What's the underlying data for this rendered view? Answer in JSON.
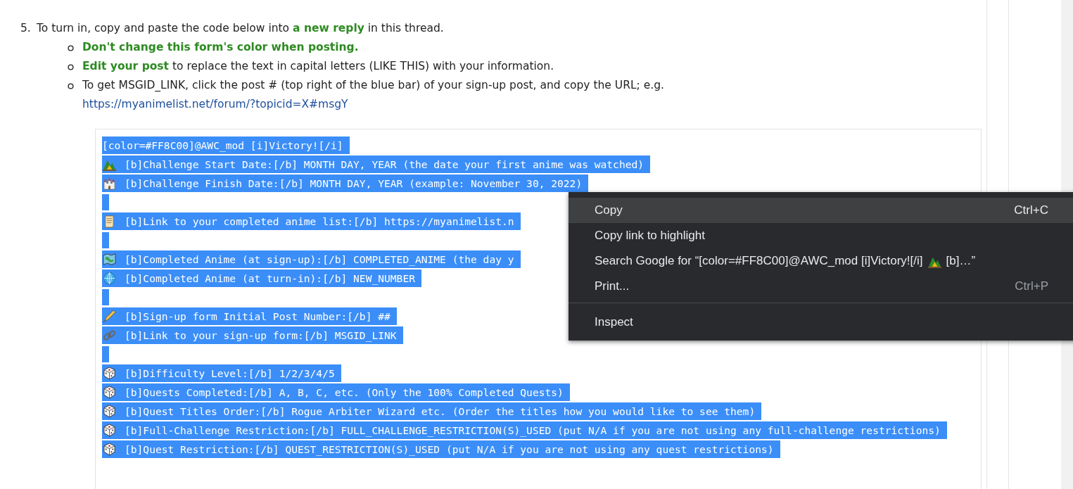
{
  "instructions": {
    "number": "5.",
    "text": "To turn in, copy and paste the code below into **a new reply** in this thread.",
    "bullets": [
      {
        "text": "**Don't change this form's color when posting.**"
      },
      {
        "text": "**Edit your post** to replace the text in capital letters (LIKE THIS) with your information."
      },
      {
        "text": "To get MSGID_LINK, click the post # (top right of the blue bar) of your sign-up post, and copy the URL; e.g.",
        "link": "https://myanimelist.net/forum/?topicid=X#msgY"
      }
    ]
  },
  "code_lines": [
    {
      "kind": "plain",
      "text": "[color=#FF8C00]@AWC_mod [i]Victory![/i]"
    },
    {
      "kind": "camp",
      "text": "[b]Challenge Start Date:[/b] MONTH DAY, YEAR (the date your first anime was watched)"
    },
    {
      "kind": "castle",
      "text": "[b]Challenge Finish Date:[/b] MONTH DAY, YEAR (example: November 30, 2022)"
    },
    {
      "kind": "blank"
    },
    {
      "kind": "scroll",
      "text": "[b]Link to your completed anime list:[/b] https://myanimelist.n"
    },
    {
      "kind": "blank"
    },
    {
      "kind": "map",
      "text": "[b]Completed Anime (at sign-up):[/b] COMPLETED_ANIME (the day y"
    },
    {
      "kind": "globe",
      "text": "[b]Completed Anime (at turn-in):[/b] NEW_NUMBER"
    },
    {
      "kind": "blank"
    },
    {
      "kind": "pen",
      "text": "[b]Sign-up form Initial Post Number:[/b] ##"
    },
    {
      "kind": "link",
      "text": "[b]Link to your sign-up form:[/b] MSGID_LINK"
    },
    {
      "kind": "blank"
    },
    {
      "kind": "dice",
      "text": "[b]Difficulty Level:[/b] 1/2/3/4/5"
    },
    {
      "kind": "dice",
      "text": "[b]Quests Completed:[/b] A, B, C, etc. (Only the 100% Completed Quests)"
    },
    {
      "kind": "dice",
      "text": "[b]Quest Titles Order:[/b] Rogue Arbiter Wizard etc. (Order the titles how you would like to see them)"
    },
    {
      "kind": "dice",
      "text": "[b]Full-Challenge Restriction:[/b] FULL_CHALLENGE_RESTRICTION(S)_USED (put N/A if you are not using any full-challenge restrictions)"
    },
    {
      "kind": "dice",
      "text": "[b]Quest Restriction:[/b] QUEST_RESTRICTION(S)_USED (put N/A if you are not using any quest restrictions)"
    }
  ],
  "context_menu": {
    "groups": [
      [
        {
          "label": "Copy",
          "shortcut": "Ctrl+C",
          "highlighted": true
        },
        {
          "label": "Copy link to highlight",
          "highlighted": false
        },
        {
          "label": "Search Google for “[color=#FF8C00]@AWC_mod [i]Victory![/i]",
          "suffix": "[b]…”",
          "highlighted": false
        },
        {
          "label": "Print...",
          "shortcut": "Ctrl+P",
          "highlighted": false
        }
      ],
      [
        {
          "label": "Inspect",
          "highlighted": false
        }
      ]
    ]
  }
}
